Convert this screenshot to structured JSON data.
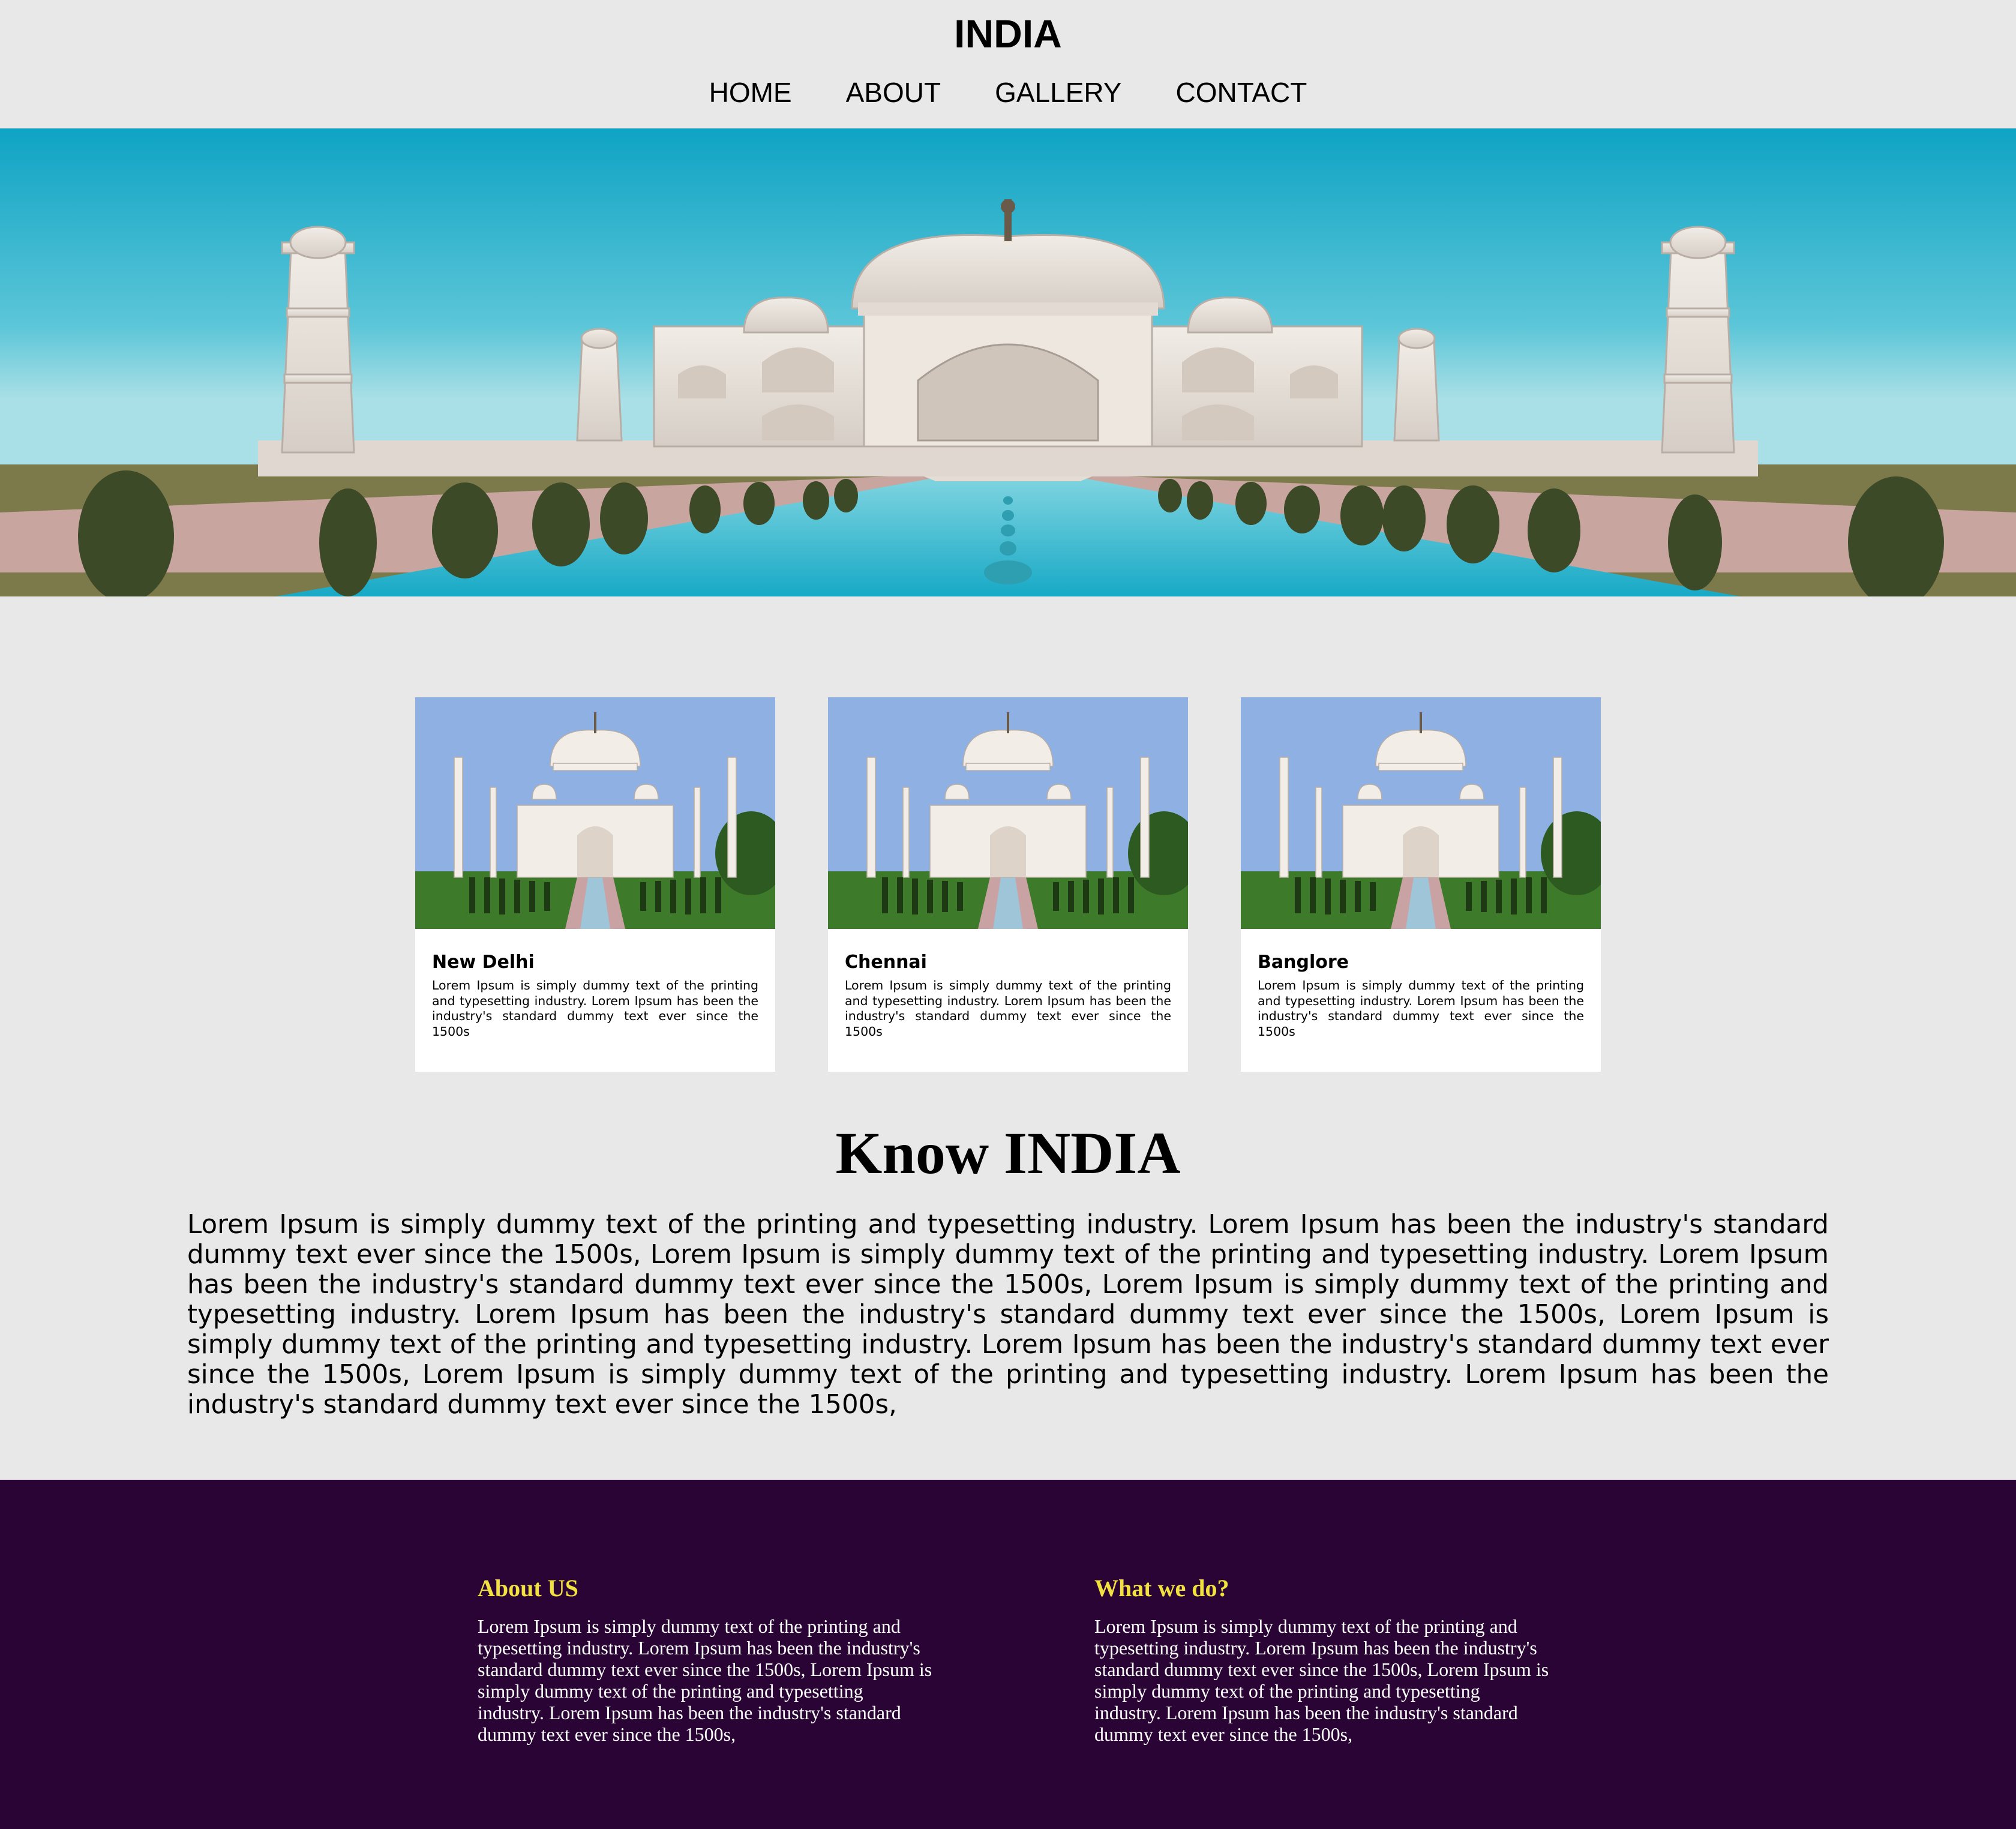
{
  "header": {
    "title": "INDIA",
    "nav": [
      "HOME",
      "ABOUT",
      "GALLERY",
      "CONTACT"
    ]
  },
  "hero": {
    "image_alt": "Taj Mahal with reflecting pool"
  },
  "cards": [
    {
      "title": "New Delhi",
      "text": "Lorem Ipsum is simply dummy text of the printing and typesetting industry. Lorem Ipsum has been the industry's standard dummy text ever since the 1500s"
    },
    {
      "title": "Chennai",
      "text": "Lorem Ipsum is simply dummy text of the printing and typesetting industry. Lorem Ipsum has been the industry's standard dummy text ever since the 1500s"
    },
    {
      "title": "Banglore",
      "text": "Lorem Ipsum is simply dummy text of the printing and typesetting industry. Lorem Ipsum has been the industry's standard dummy text ever since the 1500s"
    }
  ],
  "know": {
    "title": "Know INDIA",
    "text": "Lorem Ipsum is simply dummy text of the printing and typesetting industry. Lorem Ipsum has been the industry's standard dummy text ever since the 1500s, Lorem Ipsum is simply dummy text of the printing and typesetting industry. Lorem Ipsum has been the industry's standard dummy text ever since the 1500s, Lorem Ipsum is simply dummy text of the printing and typesetting industry. Lorem Ipsum has been the industry's standard dummy text ever since the 1500s, Lorem Ipsum is simply dummy text of the printing and typesetting industry. Lorem Ipsum has been the industry's standard dummy text ever since the 1500s, Lorem Ipsum is simply dummy text of the printing and typesetting industry. Lorem Ipsum has been the industry's standard dummy text ever since the 1500s,"
  },
  "footer": {
    "about": {
      "title": "About US",
      "text": "Lorem Ipsum is simply dummy text of the printing and typesetting industry. Lorem Ipsum has been the industry's standard dummy text ever since the 1500s, Lorem Ipsum is simply dummy text of the printing and typesetting industry. Lorem Ipsum has been the industry's standard dummy text ever since the 1500s,"
    },
    "what": {
      "title": "What we do?",
      "text": "Lorem Ipsum is simply dummy text of the printing and typesetting industry. Lorem Ipsum has been the industry's standard dummy text ever since the 1500s, Lorem Ipsum is simply dummy text of the printing and typesetting industry. Lorem Ipsum has been the industry's standard dummy text ever since the 1500s,"
    }
  },
  "colors": {
    "page_bg": "#e8e8e8",
    "footer_bg": "#2a0434",
    "footer_heading": "#f0e040",
    "footer_text": "#ffffff"
  }
}
